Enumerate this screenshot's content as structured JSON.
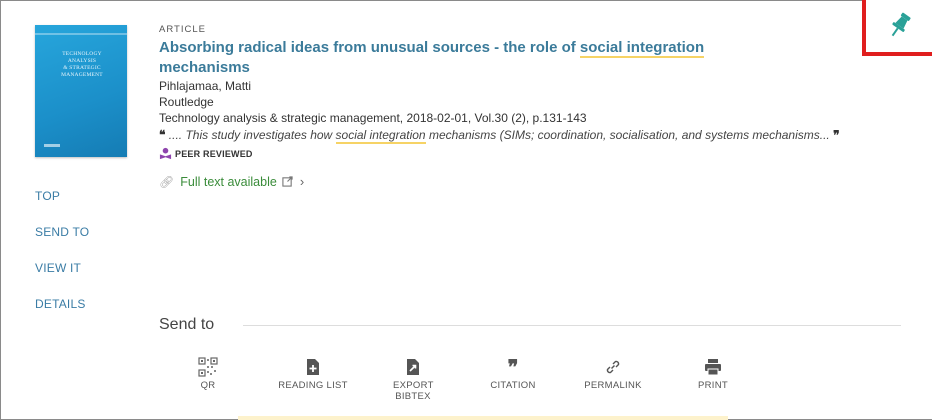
{
  "cover": {
    "title_lines": [
      "TECHNOLOGY",
      "ANALYSIS",
      "& STRATEGIC",
      "MANAGEMENT"
    ],
    "color": "#1b8fc9"
  },
  "nav": {
    "items": [
      "TOP",
      "SEND TO",
      "VIEW IT",
      "DETAILS"
    ],
    "color": "#3a7ca5"
  },
  "record": {
    "type": "ARTICLE",
    "title_pre": "Absorbing radical ideas from unusual sources - the role of ",
    "title_highlight": "social integration",
    "title_post": " mechanisms",
    "author": "Pihlajamaa, Matti",
    "publisher": "Routledge",
    "source": "Technology analysis & strategic management, 2018-02-01, Vol.30 (2), p.131-143",
    "snippet_open": "❝",
    "snippet_pre": " .... This study investigates how ",
    "snippet_highlight": "social integration",
    "snippet_post": " mechanisms (SIMs; coordination, socialisation, and systems mechanisms...",
    "snippet_close": "❞",
    "peer_reviewed": "PEER REVIEWED",
    "fulltext": "Full text available",
    "title_color": "#3b7b9a",
    "fulltext_color": "#3a8c3a",
    "highlight_color": "#f6d365"
  },
  "sendto": {
    "title": "Send to",
    "actions": [
      {
        "icon": "qr-code-icon",
        "label": "QR"
      },
      {
        "icon": "reading-list-icon",
        "label": "READING LIST"
      },
      {
        "icon": "export-bibtex-icon",
        "label": "EXPORT BIBTEX"
      },
      {
        "icon": "citation-icon",
        "label": "CITATION"
      },
      {
        "icon": "permalink-icon",
        "label": "PERMALINK"
      },
      {
        "icon": "print-icon",
        "label": "PRINT"
      }
    ]
  },
  "pin": {
    "icon": "pin-icon",
    "color": "#2aa198",
    "box_color": "#e01e1e"
  }
}
